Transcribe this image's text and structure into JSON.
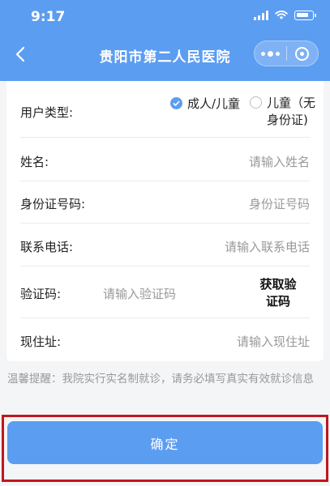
{
  "status_bar": {
    "time": "9:17"
  },
  "navbar": {
    "title": "贵阳市第二人民医院"
  },
  "form": {
    "user_type_label": "用户类型:",
    "option_adult_child": "成人/儿童",
    "option_child_no_id": "儿童（无身份证)",
    "name_label": "姓名:",
    "name_placeholder": "请输入姓名",
    "id_label": "身份证号码:",
    "id_placeholder": "身份证号码",
    "phone_label": "联系电话:",
    "phone_placeholder": "请输入联系电话",
    "code_label": "验证码:",
    "code_placeholder": "请输入验证码",
    "get_code_label": "获取验证码",
    "address_label": "现住址:",
    "address_placeholder": "请输入现住址",
    "selected_user_type": "成人/儿童"
  },
  "notice": "温馨提醒：我院实行实名制就诊，请务必填写真实有效就诊信息",
  "confirm_label": "确定",
  "colors": {
    "primary": "#5b9df1",
    "highlight_border": "#c0171e"
  }
}
